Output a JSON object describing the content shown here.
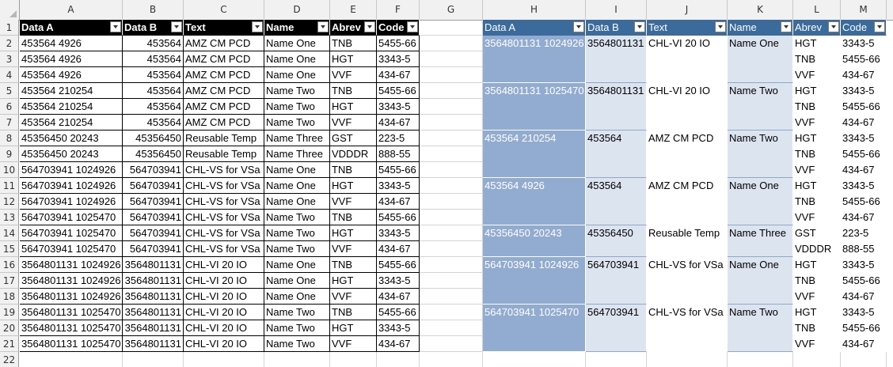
{
  "columns": [
    "A",
    "B",
    "C",
    "D",
    "E",
    "F",
    "G",
    "H",
    "I",
    "J",
    "K",
    "L",
    "M"
  ],
  "rows": [
    "1",
    "2",
    "3",
    "4",
    "5",
    "6",
    "7",
    "8",
    "9",
    "10",
    "11",
    "12",
    "13",
    "14",
    "15",
    "16",
    "17",
    "18",
    "19",
    "20",
    "21",
    "22"
  ],
  "left_table": {
    "headers": [
      "Data A",
      "Data B",
      "Text",
      "Name",
      "Abrev",
      "Code"
    ],
    "rows": [
      [
        "453564 4926",
        "453564",
        "AMZ CM PCD",
        "Name One",
        "TNB",
        "5455-66"
      ],
      [
        "453564 4926",
        "453564",
        "AMZ CM PCD",
        "Name One",
        "HGT",
        "3343-5"
      ],
      [
        "453564 4926",
        "453564",
        "AMZ CM PCD",
        "Name One",
        "VVF",
        "434-67"
      ],
      [
        "453564 210254",
        "453564",
        "AMZ CM PCD",
        "Name Two",
        "TNB",
        "5455-66"
      ],
      [
        "453564 210254",
        "453564",
        "AMZ CM PCD",
        "Name Two",
        "HGT",
        "3343-5"
      ],
      [
        "453564 210254",
        "453564",
        "AMZ CM PCD",
        "Name Two",
        "VVF",
        "434-67"
      ],
      [
        "45356450 20243",
        "45356450",
        "Reusable Temp",
        "Name Three",
        "GST",
        "223-5"
      ],
      [
        "45356450 20243",
        "45356450",
        "Reusable Temp",
        "Name Three",
        "VDDDR",
        "888-55"
      ],
      [
        "564703941 1024926",
        "564703941",
        "CHL-VS for VSa",
        "Name One",
        "TNB",
        "5455-66"
      ],
      [
        "564703941 1024926",
        "564703941",
        "CHL-VS for VSa",
        "Name One",
        "HGT",
        "3343-5"
      ],
      [
        "564703941 1024926",
        "564703941",
        "CHL-VS for VSa",
        "Name One",
        "VVF",
        "434-67"
      ],
      [
        "564703941 1025470",
        "564703941",
        "CHL-VS for VSa",
        "Name Two",
        "TNB",
        "5455-66"
      ],
      [
        "564703941 1025470",
        "564703941",
        "CHL-VS for VSa",
        "Name Two",
        "HGT",
        "3343-5"
      ],
      [
        "564703941 1025470",
        "564703941",
        "CHL-VS for VSa",
        "Name Two",
        "VVF",
        "434-67"
      ],
      [
        "3564801131 1024926",
        "3564801131",
        "CHL-VI 20 IO",
        "Name One",
        "TNB",
        "5455-66"
      ],
      [
        "3564801131 1024926",
        "3564801131",
        "CHL-VI 20 IO",
        "Name One",
        "HGT",
        "3343-5"
      ],
      [
        "3564801131 1024926",
        "3564801131",
        "CHL-VI 20 IO",
        "Name One",
        "VVF",
        "434-67"
      ],
      [
        "3564801131 1025470",
        "3564801131",
        "CHL-VI 20 IO",
        "Name Two",
        "TNB",
        "5455-66"
      ],
      [
        "3564801131 1025470",
        "3564801131",
        "CHL-VI 20 IO",
        "Name Two",
        "HGT",
        "3343-5"
      ],
      [
        "3564801131 1025470",
        "3564801131",
        "CHL-VI 20 IO",
        "Name Two",
        "VVF",
        "434-67"
      ]
    ]
  },
  "right_table": {
    "headers": [
      "Data A",
      "Data B",
      "Text",
      "Name",
      "Abrev",
      "Code"
    ],
    "groups": [
      {
        "data_a": "3564801131 1024926",
        "data_b": "3564801131",
        "text": "CHL-VI 20 IO",
        "name": "Name One",
        "items": [
          [
            "HGT",
            "3343-5"
          ],
          [
            "TNB",
            "5455-66"
          ],
          [
            "VVF",
            "434-67"
          ]
        ]
      },
      {
        "data_a": "3564801131 1025470",
        "data_b": "3564801131",
        "text": "CHL-VI 20 IO",
        "name": "Name Two",
        "items": [
          [
            "HGT",
            "3343-5"
          ],
          [
            "TNB",
            "5455-66"
          ],
          [
            "VVF",
            "434-67"
          ]
        ]
      },
      {
        "data_a": "453564 210254",
        "data_b": "453564",
        "text": "AMZ CM PCD",
        "name": "Name Two",
        "items": [
          [
            "HGT",
            "3343-5"
          ],
          [
            "TNB",
            "5455-66"
          ],
          [
            "VVF",
            "434-67"
          ]
        ]
      },
      {
        "data_a": "453564 4926",
        "data_b": "453564",
        "text": "AMZ CM PCD",
        "name": "Name One",
        "items": [
          [
            "HGT",
            "3343-5"
          ],
          [
            "TNB",
            "5455-66"
          ],
          [
            "VVF",
            "434-67"
          ]
        ]
      },
      {
        "data_a": "45356450 20243",
        "data_b": "45356450",
        "text": "Reusable Temp",
        "name": "Name Three",
        "items": [
          [
            "GST",
            "223-5"
          ],
          [
            "VDDDR",
            "888-55"
          ]
        ]
      },
      {
        "data_a": "564703941 1024926",
        "data_b": "564703941",
        "text": "CHL-VS for VSa",
        "name": "Name One",
        "items": [
          [
            "HGT",
            "3343-5"
          ],
          [
            "TNB",
            "5455-66"
          ],
          [
            "VVF",
            "434-67"
          ]
        ]
      },
      {
        "data_a": "564703941 1025470",
        "data_b": "564703941",
        "text": "CHL-VS for VSa",
        "name": "Name Two",
        "items": [
          [
            "HGT",
            "3343-5"
          ],
          [
            "TNB",
            "5455-66"
          ],
          [
            "VVF",
            "434-67"
          ]
        ]
      }
    ]
  },
  "colors": {
    "left_header_bg": "#000000",
    "right_header_bg": "#3b6a9c",
    "group_bg": "#92abd1",
    "light_bg": "#dce4f0"
  }
}
